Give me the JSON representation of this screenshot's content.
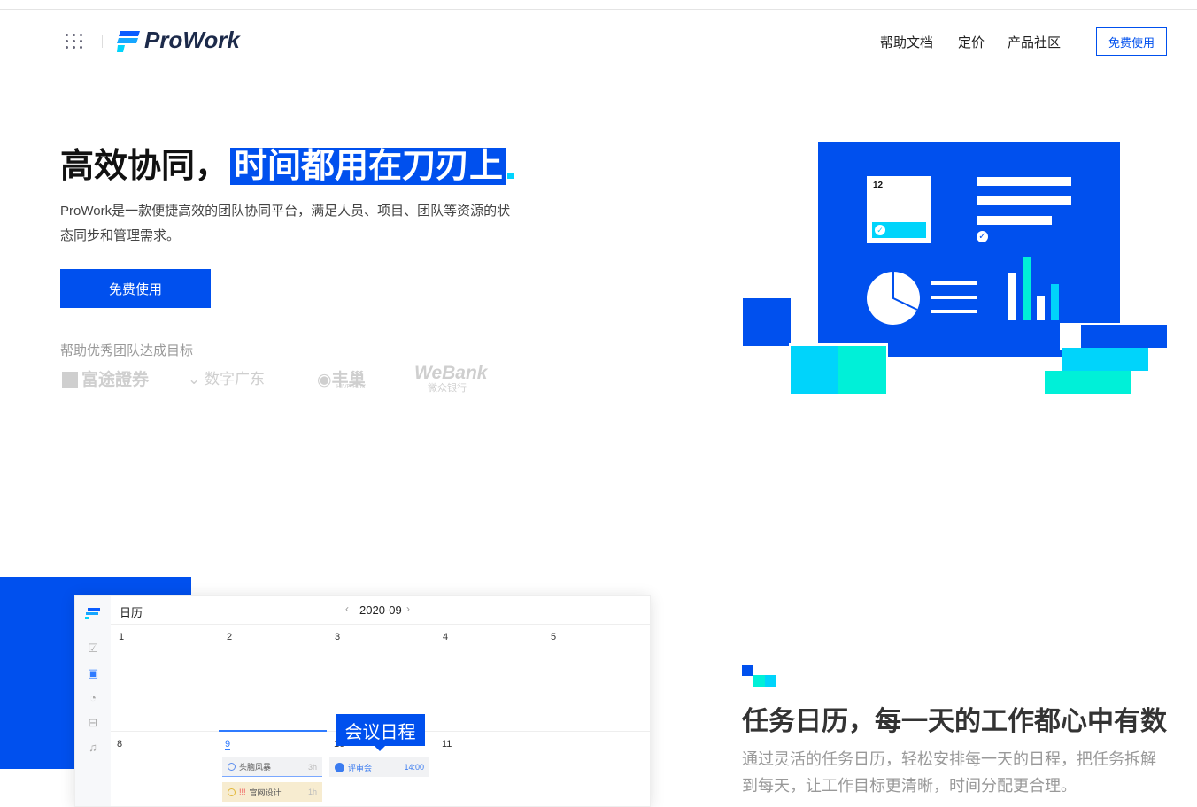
{
  "header": {
    "brand": "ProWork",
    "nav": [
      "帮助文档",
      "定价",
      "产品社区"
    ],
    "cta": "免费使用"
  },
  "hero": {
    "title_prefix": "高效协同，",
    "title_highlight": "时间都用在刀刃上",
    "description": "ProWork是一款便捷高效的团队协同平台，满足人员、项目、团队等资源的状态同步和管理需求。",
    "cta": "免费使用",
    "illustration_date": "12"
  },
  "partners": {
    "label": "帮助优秀团队达成目标",
    "logos": [
      "富途證券",
      "数字广东",
      "丰巢",
      "HIVE BOX",
      "WeBank",
      "微众银行"
    ]
  },
  "calendar": {
    "title": "日历",
    "month": "2020-09",
    "week1": [
      "1",
      "2",
      "3",
      "4",
      "5"
    ],
    "week2": [
      "8",
      "9",
      "10",
      "11"
    ],
    "tasks": [
      {
        "name": "头脑风暴",
        "time": "3h"
      },
      {
        "name": "官网设计",
        "time": "1h",
        "flag": "!!!"
      },
      {
        "name": "评审会",
        "time": "14:00"
      }
    ],
    "tooltip": "会议日程"
  },
  "feature": {
    "title": "任务日历，每一天的工作都心中有数",
    "description": "通过灵活的任务日历，轻松安排每一天的日程，把任务拆解到每天，让工作目标更清晰，时间分配更合理。"
  },
  "colors": {
    "brand": "#0050ee",
    "cyan": "#00d4fb",
    "teal": "#00f0d8"
  }
}
